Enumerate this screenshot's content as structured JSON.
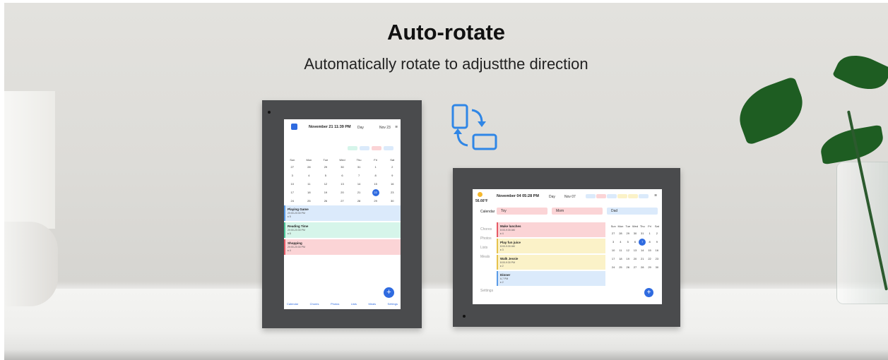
{
  "heading": {
    "title": "Auto-rotate",
    "subtitle": "Automatically rotate to adjustthe direction"
  },
  "colors": {
    "accent": "#2f6be0",
    "frame": "#4a4b4d",
    "event_blue": "#dbeafb",
    "event_green": "#d6f5ea",
    "event_red": "#fbd4d6",
    "event_yellow": "#fbf2c8"
  },
  "icons": [
    "rotate-icon",
    "calendar-app-icon",
    "wifi-icon",
    "add-icon",
    "weather-sun-icon"
  ],
  "portrait": {
    "header": {
      "date": "November 21",
      "time": "11:39 PM",
      "view": "Day",
      "range": "Nov 23"
    },
    "weekdays": [
      "Sun",
      "Mon",
      "Tue",
      "Wed",
      "Thu",
      "Fri",
      "Sat"
    ],
    "days": [
      "27",
      "28",
      "29",
      "30",
      "31",
      "1",
      "2",
      "3",
      "4",
      "5",
      "6",
      "7",
      "8",
      "9",
      "10",
      "11",
      "12",
      "13",
      "14",
      "15",
      "16",
      "17",
      "18",
      "19",
      "20",
      "21",
      "22",
      "23",
      "24",
      "25",
      "26",
      "27",
      "28",
      "29",
      "30"
    ],
    "selected_day": "22",
    "events": [
      {
        "title": "Playing Game",
        "time": "20:00-20:30 PM",
        "tag": "♦ 5"
      },
      {
        "title": "Reading Time",
        "time": "20:00-20:30 PM",
        "tag": "♦ 8"
      },
      {
        "title": "Shopping",
        "time": "20:00-20:30 PM",
        "tag": "♦ 4"
      }
    ],
    "nav": [
      "Calendar",
      "Chores",
      "Photos",
      "Lists",
      "Meals",
      "Settings"
    ],
    "fab": "+"
  },
  "landscape": {
    "header": {
      "date": "November 04",
      "time": "05:28 PM",
      "view": "Day",
      "range": "Nov 07"
    },
    "weather": "56.66°F",
    "members": [
      "Toy",
      "Mom",
      "Dad"
    ],
    "sidebar": [
      "Calendar",
      "Chores",
      "Photos",
      "Lists",
      "Meals",
      "Settings"
    ],
    "events": [
      {
        "title": "Make lunches",
        "time": "8:00-9:30 AM",
        "tag": "♦ 4"
      },
      {
        "title": "Play fun juice",
        "time": "8:00-9:30 AM",
        "tag": "♦ 3"
      },
      {
        "title": "Walk Jessie",
        "time": "8:00-9:30 PM",
        "tag": "♦ 2"
      },
      {
        "title": "Dinner",
        "time": "6-7 PM",
        "tag": "♦ 2"
      }
    ],
    "weekdays": [
      "Sun",
      "Mon",
      "Tue",
      "Wed",
      "Thu",
      "Fri",
      "Sat"
    ],
    "days": [
      "27",
      "28",
      "29",
      "30",
      "31",
      "1",
      "2",
      "3",
      "4",
      "5",
      "6",
      "7",
      "8",
      "9",
      "10",
      "11",
      "12",
      "13",
      "14",
      "15",
      "16",
      "17",
      "18",
      "19",
      "20",
      "21",
      "22",
      "23",
      "24",
      "25",
      "26",
      "27",
      "28",
      "29",
      "30"
    ],
    "selected_day": "7",
    "fab": "+"
  }
}
